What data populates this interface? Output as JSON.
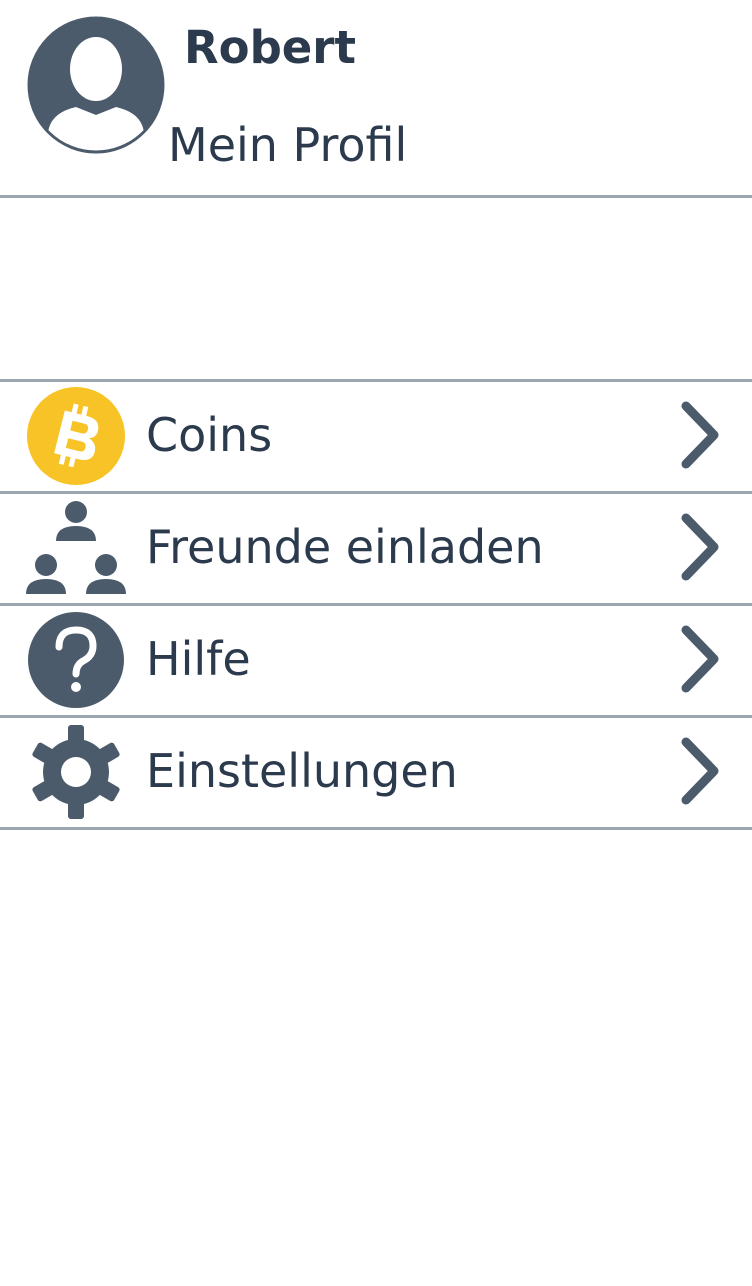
{
  "profile": {
    "name": "Robert",
    "link_label": "Mein Profil",
    "avatar_icon": "user-avatar-icon"
  },
  "menu": {
    "items": [
      {
        "label": "Coins",
        "icon": "bitcoin-icon",
        "icon_color": "#f7c327"
      },
      {
        "label": "Freunde einladen",
        "icon": "invite-friends-icon",
        "icon_color": "#4b5b6b"
      },
      {
        "label": "Hilfe",
        "icon": "help-icon",
        "icon_color": "#4b5b6b"
      },
      {
        "label": "Einstellungen",
        "icon": "settings-icon",
        "icon_color": "#4b5b6b"
      }
    ],
    "chevron_icon": "chevron-right-icon"
  },
  "colors": {
    "text": "#2b3a4c",
    "icon": "#4b5b6b",
    "coin": "#f7c327",
    "divider": "#9aa7b0",
    "background": "#ffffff"
  }
}
